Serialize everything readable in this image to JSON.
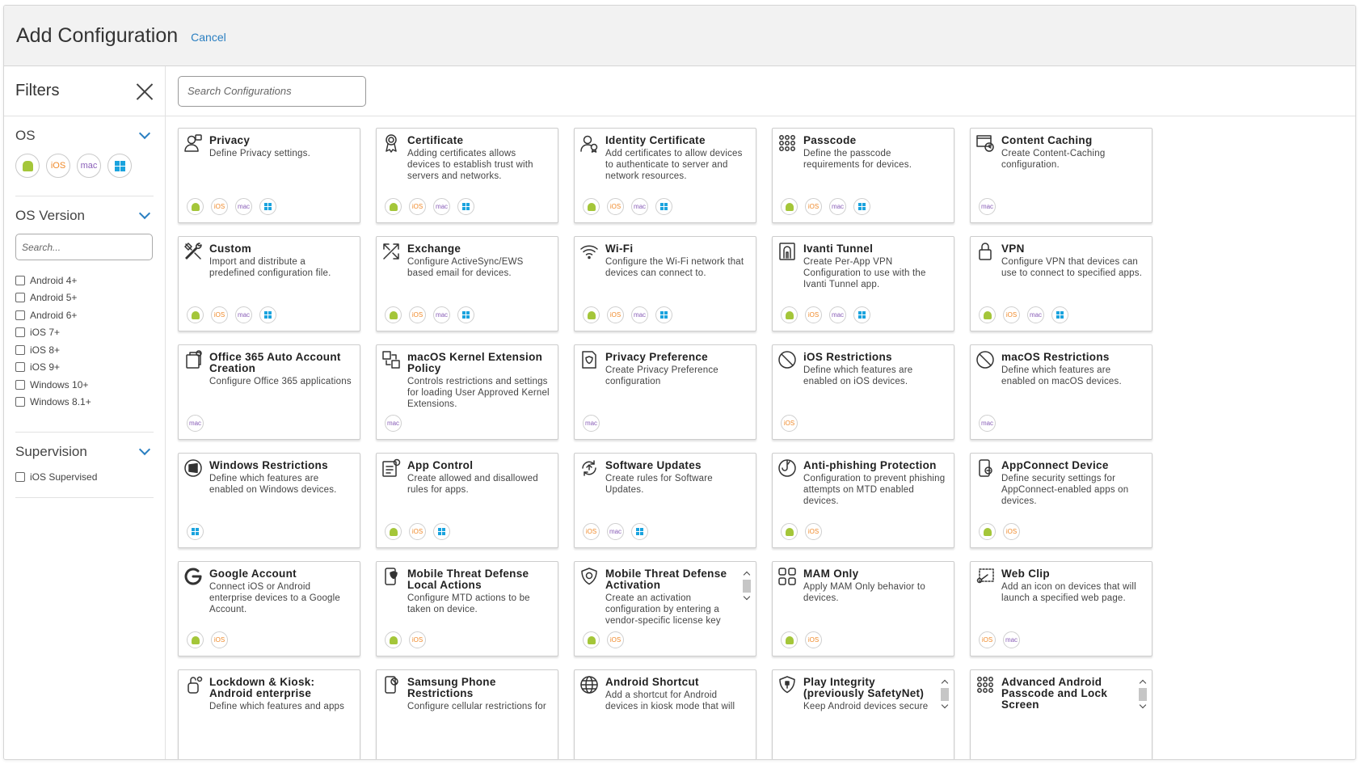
{
  "header": {
    "title": "Add Configuration",
    "cancel_label": "Cancel"
  },
  "sidebar": {
    "filters_label": "Filters",
    "os": {
      "label": "OS",
      "chips": [
        {
          "name": "android",
          "label": ""
        },
        {
          "name": "ios",
          "label": "iOS"
        },
        {
          "name": "mac",
          "label": "mac"
        },
        {
          "name": "windows",
          "label": ""
        }
      ]
    },
    "os_version": {
      "label": "OS Version",
      "search_placeholder": "Search...",
      "options": [
        "Android 4+",
        "Android 5+",
        "Android 6+",
        "iOS 7+",
        "iOS 8+",
        "iOS 9+",
        "Windows 10+",
        "Windows 8.1+"
      ]
    },
    "supervision": {
      "label": "Supervision",
      "options": [
        "iOS Supervised"
      ]
    }
  },
  "search": {
    "placeholder": "Search Configurations"
  },
  "platform_labels": {
    "ios": "iOS",
    "mac": "mac"
  },
  "colors": {
    "android": "#a4c639",
    "ios": "#f08a2a",
    "mac": "#8a5fb8",
    "windows": "#1aa3de",
    "link": "#2a7fc1"
  },
  "configs": [
    {
      "title": "Privacy",
      "desc": "Define Privacy settings.",
      "icon": "person-lock-icon",
      "platforms": [
        "android",
        "ios",
        "mac",
        "windows"
      ]
    },
    {
      "title": "Certificate",
      "desc": "Adding certificates allows devices to establish trust with servers and networks.",
      "icon": "certificate-icon",
      "platforms": [
        "android",
        "ios",
        "mac",
        "windows"
      ]
    },
    {
      "title": "Identity Certificate",
      "desc": "Add certificates to allow devices to authenticate to server and network resources.",
      "icon": "identity-icon",
      "platforms": [
        "android",
        "ios",
        "mac",
        "windows"
      ]
    },
    {
      "title": "Passcode",
      "desc": "Define the passcode requirements for devices.",
      "icon": "keypad-icon",
      "platforms": [
        "android",
        "ios",
        "mac",
        "windows"
      ]
    },
    {
      "title": "Content Caching",
      "desc": "Create Content-Caching configuration.",
      "icon": "content-cache-icon",
      "platforms": [
        "mac"
      ]
    },
    {
      "title": "Custom",
      "desc": "Import and distribute a predefined configuration file.",
      "icon": "tools-icon",
      "platforms": [
        "android",
        "ios",
        "mac",
        "windows"
      ]
    },
    {
      "title": "Exchange",
      "desc": "Configure ActiveSync/EWS based email for devices.",
      "icon": "exchange-icon",
      "platforms": [
        "android",
        "ios",
        "mac",
        "windows"
      ]
    },
    {
      "title": "Wi-Fi",
      "desc": "Configure the Wi-Fi network that devices can connect to.",
      "icon": "wifi-icon",
      "platforms": [
        "android",
        "ios",
        "mac",
        "windows"
      ]
    },
    {
      "title": "Ivanti Tunnel",
      "desc": "Create Per-App VPN Configuration to use with the Ivanti Tunnel app.",
      "icon": "tunnel-icon",
      "platforms": [
        "android",
        "ios",
        "mac",
        "windows"
      ]
    },
    {
      "title": "VPN",
      "desc": "Configure VPN that devices can use to connect to specified apps.",
      "icon": "vpn-lock-icon",
      "platforms": [
        "android",
        "ios",
        "mac",
        "windows"
      ]
    },
    {
      "title": "Office 365 Auto Account Creation",
      "desc": "Configure Office 365 applications",
      "icon": "office-icon",
      "platforms": [
        "mac"
      ]
    },
    {
      "title": "macOS Kernel Extension Policy",
      "desc": "Controls restrictions and settings for loading User Approved Kernel Extensions.",
      "icon": "kernel-icon",
      "platforms": [
        "mac"
      ]
    },
    {
      "title": "Privacy Preference",
      "desc": "Create Privacy Preference configuration",
      "icon": "privacy-doc-icon",
      "platforms": [
        "mac"
      ]
    },
    {
      "title": "iOS Restrictions",
      "desc": "Define which features are enabled on iOS devices.",
      "icon": "ios-restriction-icon",
      "platforms": [
        "ios"
      ]
    },
    {
      "title": "macOS Restrictions",
      "desc": "Define which features are enabled on macOS devices.",
      "icon": "mac-restriction-icon",
      "platforms": [
        "mac"
      ]
    },
    {
      "title": "Windows Restrictions",
      "desc": "Define which features are enabled on Windows devices.",
      "icon": "windows-restriction-icon",
      "platforms": [
        "windows"
      ]
    },
    {
      "title": "App Control",
      "desc": "Create allowed and disallowed rules for apps.",
      "icon": "app-control-icon",
      "platforms": [
        "android",
        "ios",
        "windows"
      ]
    },
    {
      "title": "Software Updates",
      "desc": "Create rules for Software Updates.",
      "icon": "software-update-icon",
      "platforms": [
        "ios",
        "mac",
        "windows"
      ]
    },
    {
      "title": "Anti-phishing Protection",
      "desc": "Configuration to prevent phishing attempts on MTD enabled devices.",
      "icon": "anti-phishing-icon",
      "platforms": [
        "android",
        "ios"
      ]
    },
    {
      "title": "AppConnect Device",
      "desc": "Define security settings for AppConnect-enabled apps on devices.",
      "icon": "appconnect-icon",
      "platforms": [
        "android",
        "ios"
      ]
    },
    {
      "title": "Google Account",
      "desc": "Connect iOS or Android enterprise devices to a Google Account.",
      "icon": "google-icon",
      "platforms": [
        "android",
        "ios"
      ]
    },
    {
      "title": "Mobile Threat Defense Local Actions",
      "desc": "Configure MTD actions to be taken on device.",
      "icon": "mtd-local-icon",
      "platforms": [
        "android",
        "ios"
      ]
    },
    {
      "title": "Mobile Threat Defense Activation",
      "desc": "Create an activation configuration by entering a vendor-specific license key",
      "icon": "mtd-shield-icon",
      "platforms": [
        "android",
        "ios"
      ],
      "scroll": true
    },
    {
      "title": "MAM Only",
      "desc": "Apply MAM Only behavior to devices.",
      "icon": "mam-icon",
      "platforms": [
        "android",
        "ios"
      ]
    },
    {
      "title": "Web Clip",
      "desc": "Add an icon on devices that will launch a specified web page.",
      "icon": "web-clip-icon",
      "platforms": [
        "ios",
        "mac"
      ]
    },
    {
      "title": "Lockdown & Kiosk: Android enterprise",
      "desc": "Define which features and apps",
      "icon": "lockdown-icon",
      "platforms": []
    },
    {
      "title": "Samsung Phone Restrictions",
      "desc": "Configure cellular restrictions for",
      "icon": "phone-restriction-icon",
      "platforms": []
    },
    {
      "title": "Android Shortcut",
      "desc": "Add a shortcut for Android devices in kiosk mode that will",
      "icon": "globe-icon",
      "platforms": []
    },
    {
      "title": "Play Integrity (previously SafetyNet)",
      "desc": "Keep Android devices secure",
      "icon": "shield-icon",
      "platforms": [],
      "scroll": true
    },
    {
      "title": "Advanced Android Passcode and Lock Screen",
      "desc": "",
      "icon": "keypad-icon",
      "platforms": [],
      "scroll": true
    }
  ]
}
